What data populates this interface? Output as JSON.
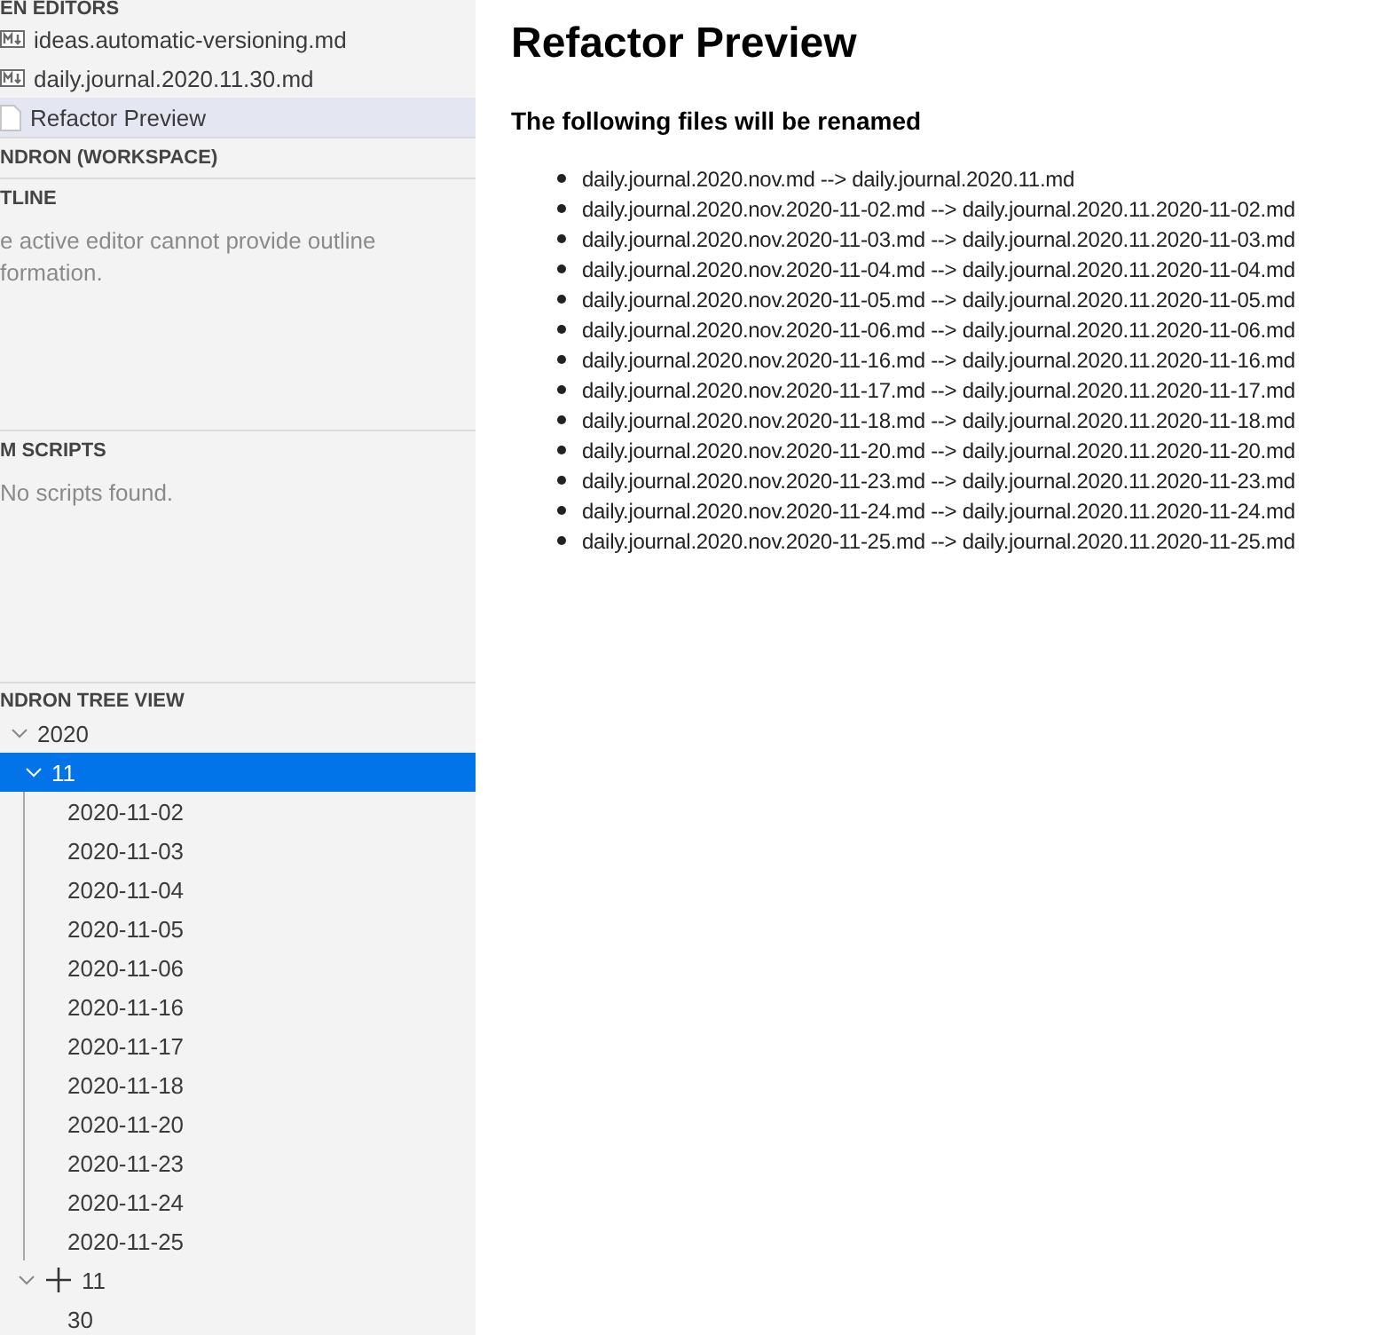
{
  "sidebar": {
    "sections": [
      {
        "title": "EN EDITORS",
        "kind": "editors",
        "items": [
          {
            "label": "ideas.automatic-versioning.md",
            "kind": "markdown",
            "selected": false
          },
          {
            "label": "daily.journal.2020.11.30.md",
            "kind": "markdown",
            "selected": false
          },
          {
            "label": "Refactor Preview",
            "kind": "file",
            "selected": true
          }
        ]
      },
      {
        "title": "NDRON (WORKSPACE)",
        "kind": "collapsed"
      },
      {
        "title": "TLINE",
        "kind": "message",
        "lines": [
          "e active editor cannot provide outline",
          "formation."
        ]
      },
      {
        "title": "M SCRIPTS",
        "kind": "message",
        "lines": [
          "No scripts found."
        ]
      },
      {
        "title": "NDRON TREE VIEW",
        "kind": "tree",
        "nodes": [
          {
            "label": "2020",
            "expanded": true,
            "selected": false,
            "children": [
              {
                "label": "11",
                "expanded": true,
                "selected": true,
                "children": [
                  {
                    "label": "2020-11-02",
                    "selected": false
                  },
                  {
                    "label": "2020-11-03",
                    "selected": false
                  },
                  {
                    "label": "2020-11-04",
                    "selected": false
                  },
                  {
                    "label": "2020-11-05",
                    "selected": false
                  },
                  {
                    "label": "2020-11-06",
                    "selected": false
                  },
                  {
                    "label": "2020-11-16",
                    "selected": false
                  },
                  {
                    "label": "2020-11-17",
                    "selected": false
                  },
                  {
                    "label": "2020-11-18",
                    "selected": false
                  },
                  {
                    "label": "2020-11-20",
                    "selected": false
                  },
                  {
                    "label": "2020-11-23",
                    "selected": false
                  },
                  {
                    "label": "2020-11-24",
                    "selected": false
                  },
                  {
                    "label": "2020-11-25",
                    "selected": false
                  }
                ]
              },
              {
                "label": "11",
                "kind": "plus",
                "expanded": true,
                "selected": false,
                "children": [
                  {
                    "label": "30",
                    "selected": false
                  }
                ]
              }
            ]
          }
        ]
      }
    ]
  },
  "preview": {
    "title": "Refactor Preview",
    "subtitle": "The following files will be renamed",
    "renames": [
      "daily.journal.2020.nov.md --> daily.journal.2020.11.md",
      "daily.journal.2020.nov.2020-11-02.md --> daily.journal.2020.11.2020-11-02.md",
      "daily.journal.2020.nov.2020-11-03.md --> daily.journal.2020.11.2020-11-03.md",
      "daily.journal.2020.nov.2020-11-04.md --> daily.journal.2020.11.2020-11-04.md",
      "daily.journal.2020.nov.2020-11-05.md --> daily.journal.2020.11.2020-11-05.md",
      "daily.journal.2020.nov.2020-11-06.md --> daily.journal.2020.11.2020-11-06.md",
      "daily.journal.2020.nov.2020-11-16.md --> daily.journal.2020.11.2020-11-16.md",
      "daily.journal.2020.nov.2020-11-17.md --> daily.journal.2020.11.2020-11-17.md",
      "daily.journal.2020.nov.2020-11-18.md --> daily.journal.2020.11.2020-11-18.md",
      "daily.journal.2020.nov.2020-11-20.md --> daily.journal.2020.11.2020-11-20.md",
      "daily.journal.2020.nov.2020-11-23.md --> daily.journal.2020.11.2020-11-23.md",
      "daily.journal.2020.nov.2020-11-24.md --> daily.journal.2020.11.2020-11-24.md",
      "daily.journal.2020.nov.2020-11-25.md --> daily.journal.2020.11.2020-11-25.md"
    ]
  }
}
